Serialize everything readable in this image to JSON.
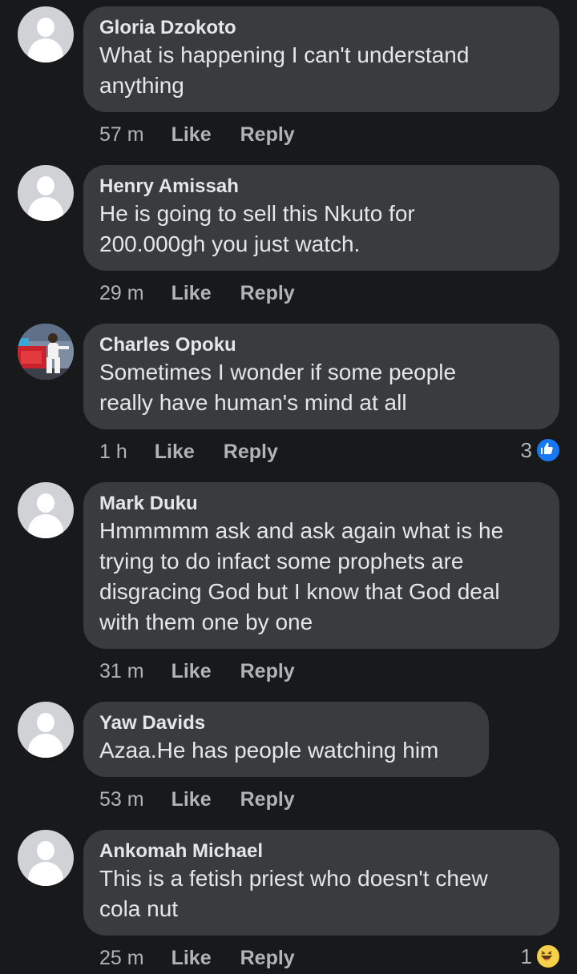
{
  "comments": [
    {
      "author": "Gloria Dzokoto",
      "text": "What is happening I can't understand\nanything",
      "time": "57 m",
      "like": "Like",
      "reply": "Reply"
    },
    {
      "author": "Henry Amissah",
      "text": "He is going to sell this Nkuto for\n200.000gh you just watch.",
      "time": "29 m",
      "like": "Like",
      "reply": "Reply"
    },
    {
      "author": "Charles Opoku",
      "text": "Sometimes I wonder if some people\nreally have human's mind at all",
      "time": "1 h",
      "like": "Like",
      "reply": "Reply",
      "reaction_count": "3",
      "reaction_icon": "like-icon"
    },
    {
      "author": "Mark Duku",
      "text": "Hmmmmm ask and ask again what is he\ntrying to do infact some prophets are\ndisgracing God but I know that God deal\nwith them one by one",
      "time": "31 m",
      "like": "Like",
      "reply": "Reply"
    },
    {
      "author": "Yaw Davids",
      "text": "Azaa.He has people watching him",
      "time": "53 m",
      "like": "Like",
      "reply": "Reply"
    },
    {
      "author": "Ankomah Michael",
      "text": "This is a fetish priest who doesn't chew\ncola nut",
      "time": "25 m",
      "like": "Like",
      "reply": "Reply",
      "reaction_count": "1",
      "reaction_icon": "haha-icon"
    }
  ],
  "colors": {
    "background": "#18191a",
    "bubble": "#3a3b3c",
    "text": "#e4e6eb",
    "secondary_text": "#b0b3b8",
    "like_reaction": "#1877f2",
    "haha_reaction": "#f7d049"
  }
}
